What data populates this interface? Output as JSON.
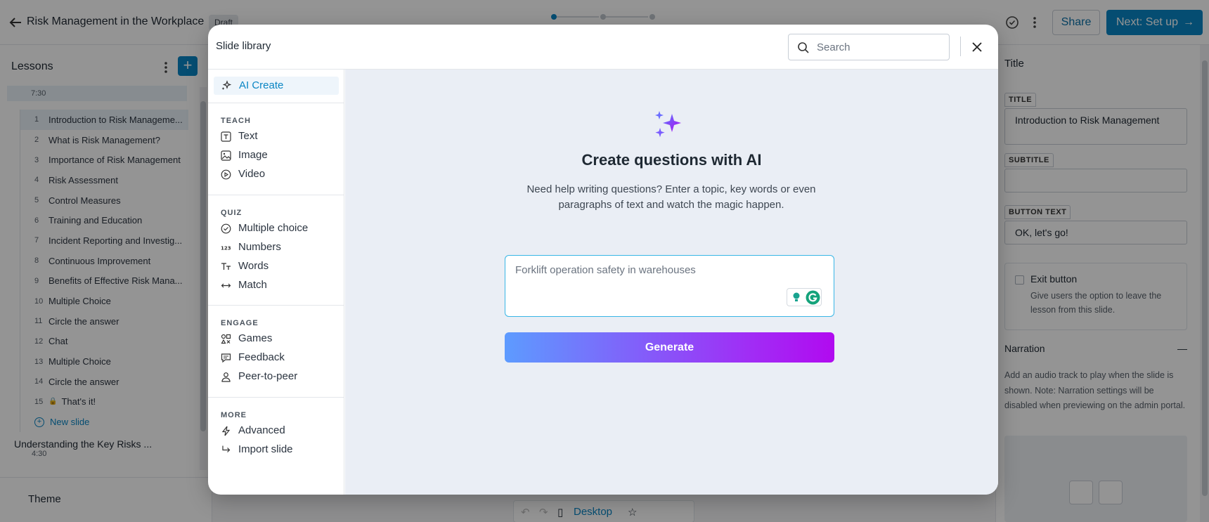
{
  "header": {
    "course_title": "Risk Management in the Workplace",
    "status_badge": "Draft",
    "share_label": "Share",
    "next_label": "Next: Set up"
  },
  "sidebar": {
    "title": "Lessons",
    "duration": "7:30",
    "slides": [
      {
        "num": "1",
        "label": "Introduction to Risk Manageme..."
      },
      {
        "num": "2",
        "label": "What is Risk Management?"
      },
      {
        "num": "3",
        "label": "Importance of Risk Management"
      },
      {
        "num": "4",
        "label": "Risk Assessment"
      },
      {
        "num": "5",
        "label": "Control Measures"
      },
      {
        "num": "6",
        "label": "Training and Education"
      },
      {
        "num": "7",
        "label": "Incident Reporting and Investig..."
      },
      {
        "num": "8",
        "label": "Continuous Improvement"
      },
      {
        "num": "9",
        "label": "Benefits of Effective Risk Mana..."
      },
      {
        "num": "10",
        "label": "Multiple Choice"
      },
      {
        "num": "11",
        "label": "Circle the answer"
      },
      {
        "num": "12",
        "label": "Chat"
      },
      {
        "num": "13",
        "label": "Multiple Choice"
      },
      {
        "num": "14",
        "label": "Circle the answer"
      },
      {
        "num": "15",
        "label": "That's it!"
      }
    ],
    "new_slide_label": "New slide",
    "module_title": "Understanding the Key Risks ...",
    "module_duration": "4:30",
    "theme_label": "Theme"
  },
  "right_panel": {
    "title": "Title",
    "title_label": "TITLE",
    "title_value": "Introduction to Risk Management",
    "subtitle_label": "SUBTITLE",
    "subtitle_value": "",
    "button_text_label": "BUTTON TEXT",
    "button_text_value": "OK, let's go!",
    "exit_button_label": "Exit button",
    "exit_button_desc": "Give users the option to leave the lesson from this slide.",
    "narration_label": "Narration",
    "narration_desc": "Add an audio track to play when the slide is shown. Note: Narration settings will be disabled when previewing on the admin portal."
  },
  "canvas_toolbar": {
    "desktop_label": "Desktop"
  },
  "modal": {
    "title": "Slide library",
    "search_placeholder": "Search",
    "ai_create_label": "AI Create",
    "sections": {
      "teach": {
        "title": "TEACH",
        "items": [
          "Text",
          "Image",
          "Video"
        ]
      },
      "quiz": {
        "title": "QUIZ",
        "items": [
          "Multiple choice",
          "Numbers",
          "Words",
          "Match"
        ]
      },
      "engage": {
        "title": "ENGAGE",
        "items": [
          "Games",
          "Feedback",
          "Peer-to-peer"
        ]
      },
      "more": {
        "title": "MORE",
        "items": [
          "Advanced",
          "Import slide"
        ]
      }
    },
    "main": {
      "heading": "Create questions with AI",
      "description": "Need help writing questions? Enter a topic, key words or even paragraphs of text and watch the magic happen.",
      "topic_placeholder": "Forklift operation safety in warehouses",
      "generate_label": "Generate"
    }
  },
  "colors": {
    "accent": "#0a86c4",
    "generate_gradient_start": "#5d9bff",
    "generate_gradient_end": "#b10af0",
    "focus_border": "#38b6e6"
  }
}
